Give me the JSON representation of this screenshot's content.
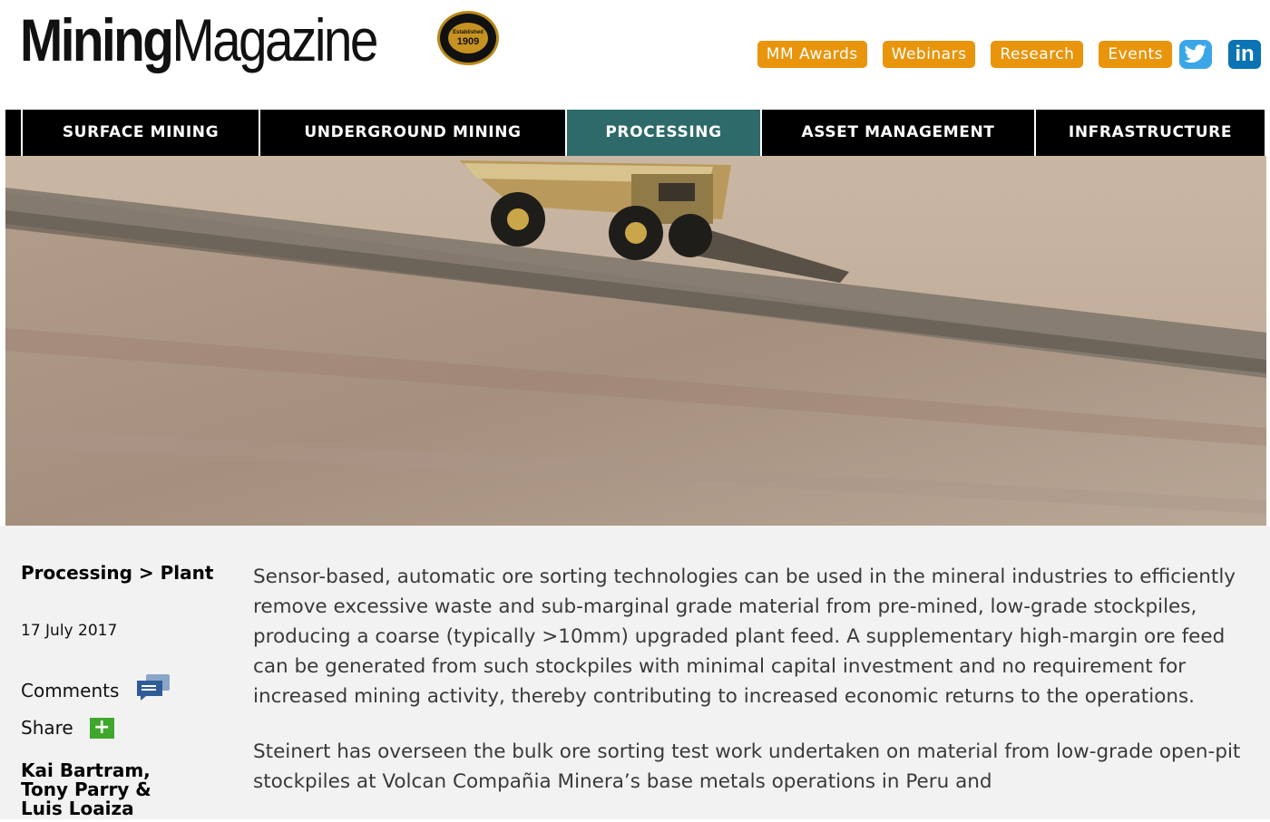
{
  "brand": {
    "name_part1": "Mining",
    "name_part2": "Magazine",
    "badge_small": "Established",
    "badge_year": "1909"
  },
  "top_links": [
    "MM Awards",
    "Webinars",
    "Research",
    "Events"
  ],
  "social": {
    "twitter": "twitter-icon",
    "linkedin_text": "in"
  },
  "nav": [
    {
      "label": "SURFACE MINING"
    },
    {
      "label": "UNDERGROUND MINING"
    },
    {
      "label": "PROCESSING"
    },
    {
      "label": "ASSET MANAGEMENT"
    },
    {
      "label": "INFRASTRUCTURE"
    }
  ],
  "colors": {
    "accent_orange": "#e8950c",
    "nav_active": "#2d6a69",
    "share_green": "#3fa82c"
  },
  "article": {
    "breadcrumb_section": "Processing",
    "breadcrumb_sep": ">",
    "breadcrumb_sub": "Plant",
    "date": "17 July 2017",
    "comments_label": "Comments",
    "share_label": "Share",
    "share_symbol": "+",
    "authors": [
      "Kai Bartram,",
      "Tony Parry &",
      "Luis Loaiza"
    ],
    "paragraphs": [
      "Sensor-based, automatic ore sorting technologies can be used in the mineral industries to efficiently remove excessive waste and sub-marginal grade material from pre-mined, low-grade stockpiles, producing a coarse (typically >10mm) upgraded plant feed. A supplementary high-margin ore feed can be generated from such stockpiles with minimal capital investment and no requirement for increased mining activity, thereby contributing to increased economic returns to the operations.",
      "Steinert has overseen the bulk ore sorting test work undertaken on material from low-grade open-pit stockpiles at Volcan Compañia Minera’s base metals operations in Peru and"
    ]
  }
}
